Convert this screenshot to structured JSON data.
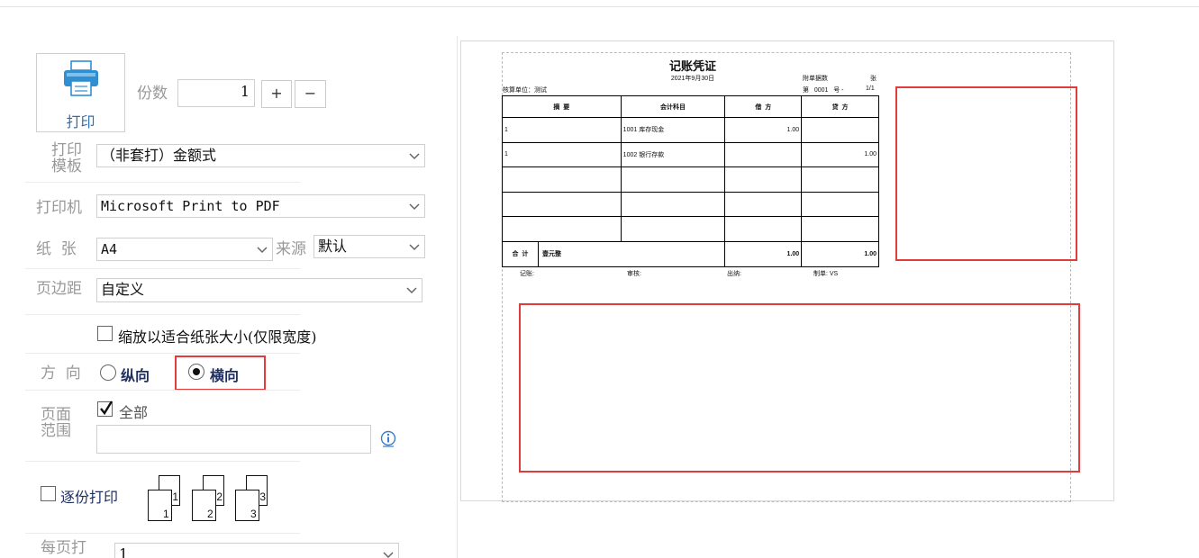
{
  "print_button": {
    "label": "打印"
  },
  "copies": {
    "label": "份数",
    "value": "1",
    "plus": "+",
    "minus": "−"
  },
  "template": {
    "label_line1": "打印",
    "label_line2": "模板",
    "value": "（非套打）金额式"
  },
  "printer": {
    "label": "打印机",
    "value": "Microsoft Print to PDF"
  },
  "paper": {
    "label": "纸  张",
    "value": "A4",
    "source_label": "来源",
    "source_value": "默认"
  },
  "margin": {
    "label": "页边距",
    "value": "自定义"
  },
  "fit": {
    "label": "缩放以适合纸张大小(仅限宽度)",
    "checked": false
  },
  "orientation": {
    "label": "方  向",
    "portrait": "纵向",
    "landscape": "横向",
    "selected": "landscape"
  },
  "range": {
    "label_line1": "页面",
    "label_line2": "范围",
    "all_label": "全部",
    "all_checked": true,
    "input_value": ""
  },
  "collate": {
    "label": "逐份打印",
    "checked": false,
    "pages": [
      "1",
      "2",
      "3"
    ]
  },
  "per_page": {
    "label_line1": "每页打",
    "value": "1"
  },
  "preview": {
    "title": "记账凭证",
    "date": "2021年9月30日",
    "attach_label": "附单据数",
    "attach_unit": "张",
    "unit_label": "核算单位：测试",
    "voucher_no": "第   0001   号 -",
    "page_ratio": "1/1",
    "headers": [
      "摘  要",
      "会计科目",
      "借  方",
      "贷  方"
    ],
    "rows": [
      {
        "summary": "1",
        "account": "1001 库存现金",
        "debit": "1.00",
        "credit": ""
      },
      {
        "summary": "1",
        "account": "1002 银行存款",
        "debit": "",
        "credit": "1.00"
      },
      {
        "summary": "",
        "account": "",
        "debit": "",
        "credit": ""
      },
      {
        "summary": "",
        "account": "",
        "debit": "",
        "credit": ""
      },
      {
        "summary": "",
        "account": "",
        "debit": "",
        "credit": ""
      }
    ],
    "total_label": "合  计",
    "total_words": "壹元整",
    "total_debit": "1.00",
    "total_credit": "1.00",
    "footer": {
      "bookkeeper": "记账:",
      "reviewer": "审核:",
      "cashier": "出纳:",
      "maker": "制单: VS"
    }
  }
}
